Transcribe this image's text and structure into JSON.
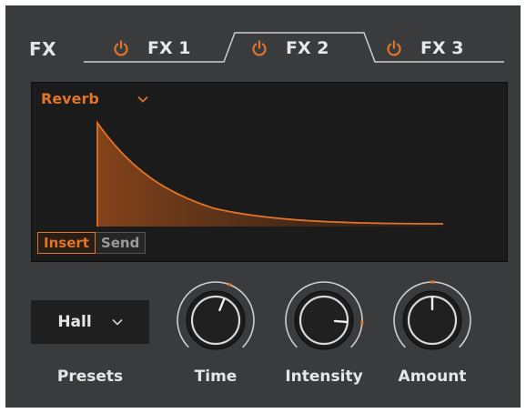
{
  "header": {
    "title": "FX"
  },
  "tabs": [
    {
      "label": "FX 1",
      "active": false,
      "power_icon": "power-icon"
    },
    {
      "label": "FX 2",
      "active": true,
      "power_icon": "power-icon"
    },
    {
      "label": "FX 3",
      "active": false,
      "power_icon": "power-icon"
    }
  ],
  "display": {
    "effect": "Reverb",
    "modes": {
      "insert": "Insert",
      "send": "Send",
      "active": "insert"
    }
  },
  "controls": {
    "preset": {
      "label": "Presets",
      "value": "Hall"
    },
    "knobs": [
      {
        "label": "Time",
        "value_fraction": 0.58
      },
      {
        "label": "Intensity",
        "value_fraction": 0.85
      },
      {
        "label": "Amount",
        "value_fraction": 0.5
      }
    ]
  },
  "colors": {
    "accent": "#e0742a",
    "panel": "#3a3b3d",
    "display": "#1b1b1c",
    "text": "#e6e6e6"
  }
}
